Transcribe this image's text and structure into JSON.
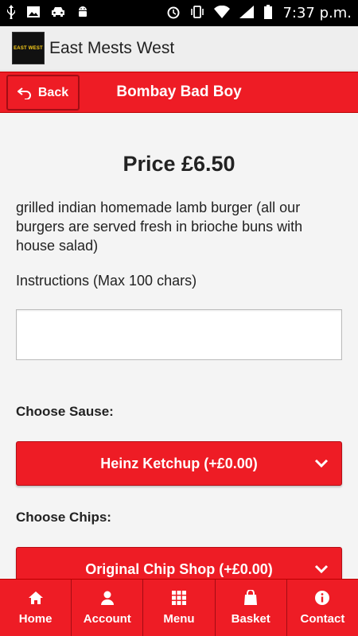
{
  "status_bar": {
    "time": "7:37 p.m."
  },
  "app": {
    "title": "East Mests West",
    "logo_text": "EAST WEST"
  },
  "header": {
    "back_label": "Back",
    "title": "Bombay Bad Boy"
  },
  "product": {
    "price": "Price £6.50",
    "description": "grilled indian homemade lamb burger (all our burgers are served fresh in brioche buns with house salad)",
    "instructions_label": "Instructions (Max 100 chars)",
    "instructions_value": ""
  },
  "options": {
    "sauce_label": "Choose Sause:",
    "sauce_selected": "Heinz Ketchup (+£0.00)",
    "chips_label": "Choose Chips:",
    "chips_selected": "Original Chip Shop (+£0.00)"
  },
  "nav": [
    {
      "label": "Home",
      "icon": "home-icon"
    },
    {
      "label": "Account",
      "icon": "user-icon"
    },
    {
      "label": "Menu",
      "icon": "grid-icon"
    },
    {
      "label": "Basket",
      "icon": "bag-icon"
    },
    {
      "label": "Contact",
      "icon": "info-icon"
    }
  ],
  "colors": {
    "accent": "#ee1c25",
    "accent_dark": "#a30d14"
  }
}
